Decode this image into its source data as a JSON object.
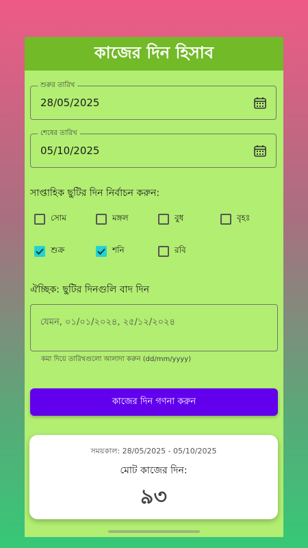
{
  "header": {
    "title": "কাজের দিন হিসাব"
  },
  "start_date": {
    "label": "শুরুর তারিখ",
    "value": "28/05/2025"
  },
  "end_date": {
    "label": "শেষের তারিখ",
    "value": "05/10/2025"
  },
  "weekly_holidays": {
    "title": "সাপ্তাহিক ছুটির দিন নির্বাচন করুন:",
    "days": [
      {
        "label": "সোম",
        "checked": false
      },
      {
        "label": "মঙ্গল",
        "checked": false
      },
      {
        "label": "বুধ",
        "checked": false
      },
      {
        "label": "বৃহঃ",
        "checked": false
      },
      {
        "label": "শুক্র",
        "checked": true
      },
      {
        "label": "শনি",
        "checked": true
      },
      {
        "label": "রবি",
        "checked": false
      }
    ]
  },
  "optional_holidays": {
    "title": "ঐচ্ছিক: ছুটির দিনগুলি বাদ দিন",
    "placeholder": "যেমন, ০১/০১/২০২৪, ২৫/১২/২০২৪",
    "helper": "কমা দিয়ে তারিখগুলো আলাদা করুন (dd/mm/yyyy)"
  },
  "calculate_button": {
    "label": "কাজের দিন গণনা করুন"
  },
  "result": {
    "period": "সময়কাল: 28/05/2025 - 05/10/2025",
    "total_label": "মোট কাজের দিন:",
    "total_value": "৯৩"
  },
  "colors": {
    "appbar": "#72ba28",
    "card_background": "#b2ee72",
    "button": "#6200ee",
    "checkbox_checked": "#22d3d3"
  }
}
